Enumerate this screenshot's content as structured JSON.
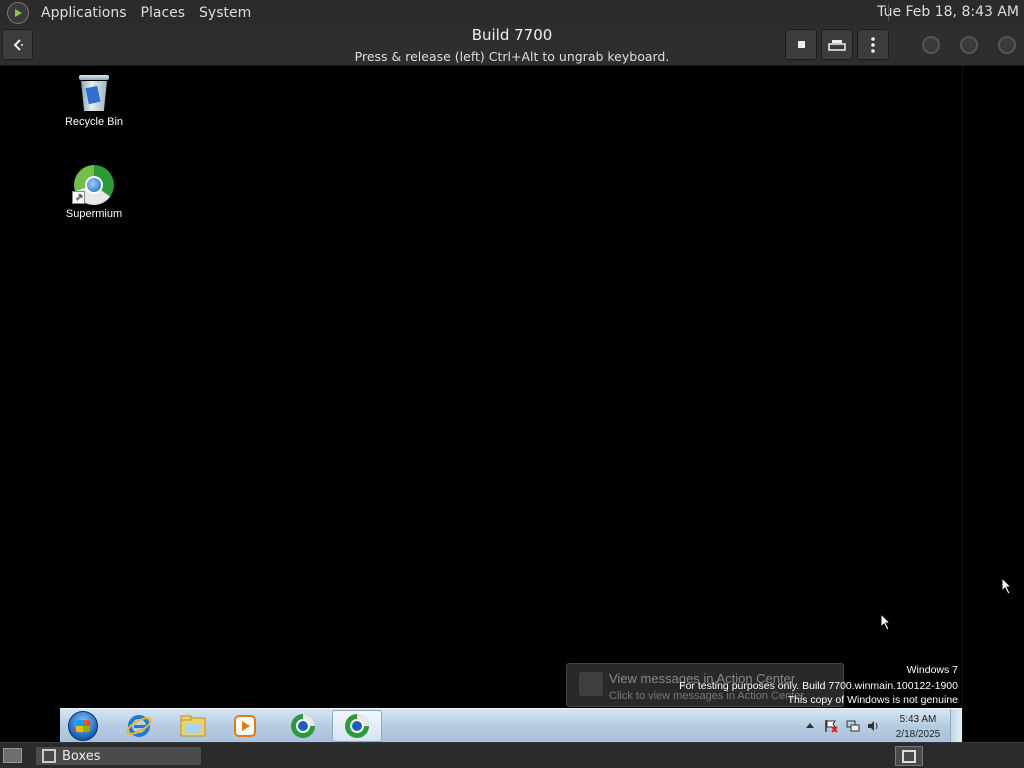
{
  "top_panel": {
    "menus": [
      "Applications",
      "Places",
      "System"
    ],
    "clock": "Tue Feb 18,  8:43 AM"
  },
  "boxes": {
    "title": "Build 7700",
    "subtitle": "Press & release (left) Ctrl+Alt to ungrab keyboard.",
    "buttons": [
      "stop-icon",
      "keyboard-icon",
      "menu-icon"
    ]
  },
  "desktop": {
    "icons": [
      {
        "label": "Recycle Bin",
        "icon": "recycle-bin-icon"
      },
      {
        "label": "Supermium",
        "icon": "supermium-icon"
      }
    ]
  },
  "notification": {
    "title": "View messages in Action Center",
    "body": "Click to view messages in Action Center"
  },
  "watermark": {
    "line1": "Windows 7",
    "line2": "For testing purposes only. Build 7700.winmain.100122-1900",
    "line3": "This copy of Windows is not genuine"
  },
  "taskbar": {
    "pinned": [
      "internet-explorer-icon",
      "windows-explorer-icon",
      "media-player-icon",
      "supermium-icon",
      "supermium-icon"
    ],
    "active_index": 4,
    "clock_time": "5:43 AM",
    "clock_date": "2/18/2025"
  },
  "bottom_panel": {
    "task_label": "Boxes"
  }
}
